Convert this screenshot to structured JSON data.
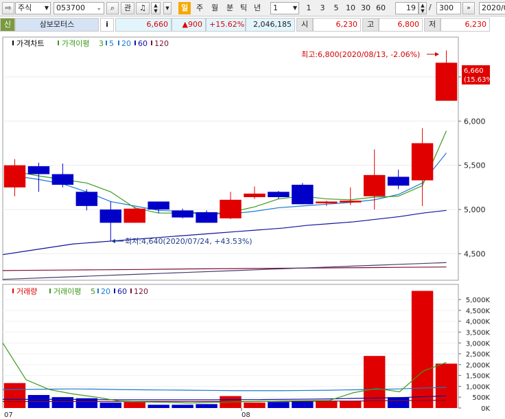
{
  "toolbar": {
    "market": "주식",
    "code": "053700",
    "watch_label": "관",
    "periods": [
      "일",
      "주",
      "월",
      "분",
      "틱",
      "년"
    ],
    "unit_value": "1",
    "unit_buttons": [
      "1",
      "3",
      "5",
      "10",
      "30",
      "60"
    ],
    "count": "19",
    "total": "300",
    "date": "2020/0"
  },
  "info": {
    "badge": "신",
    "name": "삼보모터스",
    "info_btn": "i",
    "price": "6,660",
    "change": "▲900",
    "rate": "+15.62%",
    "volume": "2,046,185",
    "open_label": "시",
    "open": "6,230",
    "high_label": "고",
    "high": "6,800",
    "low_label": "저",
    "low": "6,230"
  },
  "colors": {
    "up": "#e00000",
    "down": "#0000c8",
    "ma5": "#3a9a1a",
    "ma20": "#1a7ad0",
    "ma60": "#1010a0",
    "ma120": "#7a1030"
  },
  "price_panel": {
    "title": "가격차트",
    "legend_ma_label": "가격이평",
    "legend_values": [
      "3",
      "5",
      "20",
      "60",
      "120"
    ],
    "high_annotation": "최고:6,800(2020/08/13, -2.06%)",
    "low_annotation": "최저:4,640(2020/07/24, +43.53%)",
    "current_price": "6,660",
    "current_rate": "(15.63%)",
    "y_ticks": [
      "6,000",
      "5,500",
      "5,000",
      "4,500"
    ]
  },
  "volume_panel": {
    "title": "거래량",
    "legend_ma_label": "거래이평",
    "legend_values": [
      "5",
      "20",
      "60",
      "120"
    ],
    "y_ticks": [
      "5,000K",
      "4,500K",
      "4,000K",
      "3,500K",
      "3,000K",
      "2,500K",
      "2,000K",
      "1,500K",
      "1,000K",
      "500K",
      "0K"
    ]
  },
  "x_labels": [
    "07",
    "08"
  ],
  "chart_data": {
    "type": "candlestick",
    "candles": [
      {
        "o": 5250,
        "h": 5570,
        "l": 5150,
        "c": 5500
      },
      {
        "o": 5490,
        "h": 5530,
        "l": 5200,
        "c": 5400
      },
      {
        "o": 5400,
        "h": 5520,
        "l": 5250,
        "c": 5280
      },
      {
        "o": 5200,
        "h": 5230,
        "l": 4990,
        "c": 5040
      },
      {
        "o": 5000,
        "h": 5090,
        "l": 4640,
        "c": 4850
      },
      {
        "o": 4850,
        "h": 5030,
        "l": 4850,
        "c": 5010
      },
      {
        "o": 5090,
        "h": 5090,
        "l": 4960,
        "c": 5000
      },
      {
        "o": 4990,
        "h": 5010,
        "l": 4900,
        "c": 4910
      },
      {
        "o": 4970,
        "h": 4990,
        "l": 4860,
        "c": 4850
      },
      {
        "o": 4900,
        "h": 5200,
        "l": 4890,
        "c": 5110
      },
      {
        "o": 5140,
        "h": 5260,
        "l": 5120,
        "c": 5180
      },
      {
        "o": 5200,
        "h": 5210,
        "l": 5120,
        "c": 5140
      },
      {
        "o": 5280,
        "h": 5300,
        "l": 5060,
        "c": 5060
      },
      {
        "o": 5070,
        "h": 5100,
        "l": 5040,
        "c": 5090
      },
      {
        "o": 5080,
        "h": 5250,
        "l": 5050,
        "c": 5100
      },
      {
        "o": 5150,
        "h": 5680,
        "l": 5000,
        "c": 5390
      },
      {
        "o": 5370,
        "h": 5450,
        "l": 5230,
        "c": 5270
      },
      {
        "o": 5330,
        "h": 5920,
        "l": 5040,
        "c": 5750
      },
      {
        "o": 6230,
        "h": 6800,
        "l": 6230,
        "c": 6660
      }
    ],
    "volumes": [
      1150,
      600,
      500,
      450,
      250,
      280,
      150,
      150,
      180,
      550,
      250,
      280,
      320,
      300,
      330,
      2400,
      500,
      5400,
      2046
    ],
    "ma_price": {
      "ma5": [
        5430,
        5380,
        5340,
        5300,
        5200,
        5020,
        4960,
        4960,
        4950,
        4970,
        5030,
        5120,
        5150,
        5120,
        5110,
        5140,
        5150,
        5270,
        5890
      ],
      "ma20": [
        5380,
        5340,
        5290,
        5200,
        5090,
        5040,
        4990,
        4980,
        4950,
        4950,
        4980,
        5020,
        5040,
        5060,
        5080,
        5110,
        5170,
        5300,
        5640
      ],
      "ma60": [
        4490,
        4530,
        4570,
        4610,
        4630,
        4650,
        4670,
        4690,
        4710,
        4730,
        4750,
        4770,
        4790,
        4820,
        4840,
        4860,
        4890,
        4920,
        4960,
        4990
      ],
      "ma120": [
        4310,
        4312,
        4314,
        4316,
        4318,
        4320,
        4322,
        4325,
        4328,
        4330,
        4332,
        4334,
        4336,
        4338,
        4340,
        4342,
        4344,
        4346,
        4348,
        4350
      ],
      "ma_low": [
        4210,
        4220,
        4230,
        4240,
        4250,
        4260,
        4270,
        4280,
        4290,
        4300,
        4310,
        4320,
        4330,
        4340,
        4350,
        4360,
        4370,
        4380,
        4390,
        4400
      ]
    },
    "ma_volume": {
      "ma5": [
        3000,
        1300,
        850,
        650,
        500,
        320,
        280,
        260,
        230,
        260,
        290,
        300,
        330,
        340,
        350,
        700,
        900,
        750,
        1700,
        2100
      ],
      "ma20": [
        850,
        860,
        870,
        880,
        870,
        850,
        840,
        830,
        820,
        810,
        800,
        800,
        800,
        810,
        820,
        840,
        860,
        880,
        920,
        950
      ],
      "ma60": [
        400,
        400,
        400,
        400,
        390,
        380,
        380,
        380,
        380,
        380,
        390,
        390,
        400,
        410,
        420,
        440,
        460,
        480,
        520,
        560
      ],
      "ma120": [
        300,
        300,
        300,
        300,
        300,
        300,
        300,
        300,
        300,
        300,
        300,
        310,
        310,
        310,
        320,
        320,
        330,
        340,
        350,
        360
      ]
    },
    "price_ylim": [
      4200,
      6950
    ],
    "volume_ylim": [
      0,
      5700
    ]
  }
}
